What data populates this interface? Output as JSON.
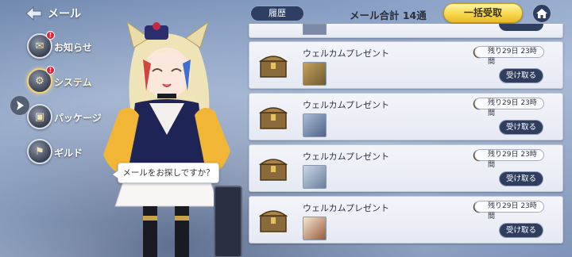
{
  "header": {
    "title": "メール"
  },
  "menu": {
    "items": [
      {
        "label": "お知らせ",
        "alert": "!",
        "active": false
      },
      {
        "label": "システム",
        "alert": "!",
        "active": true
      },
      {
        "label": "パッケージ",
        "alert": "",
        "active": false
      },
      {
        "label": "ギルド",
        "alert": "",
        "active": false
      }
    ]
  },
  "character": {
    "speech": "メールをお探しですか？"
  },
  "topbar": {
    "history_label": "履歴",
    "mail_total": "メール合計 14通",
    "bulk_claim_label": "一括受取"
  },
  "mails": [
    {
      "title": "ウェルカムプレゼント",
      "remaining": "残り29日 23時間",
      "claim_label": "受け取る"
    },
    {
      "title": "ウェルカムプレゼント",
      "remaining": "残り29日 23時間",
      "claim_label": "受け取る"
    },
    {
      "title": "ウェルカムプレゼント",
      "remaining": "残り29日 23時間",
      "claim_label": "受け取る"
    },
    {
      "title": "ウェルカムプレゼント",
      "remaining": "残り29日 23時間",
      "claim_label": "受け取る"
    }
  ],
  "colors": {
    "accent_gold": "#f7d84a",
    "button_navy": "#2f3d5f",
    "alert_red": "#d8233a"
  }
}
